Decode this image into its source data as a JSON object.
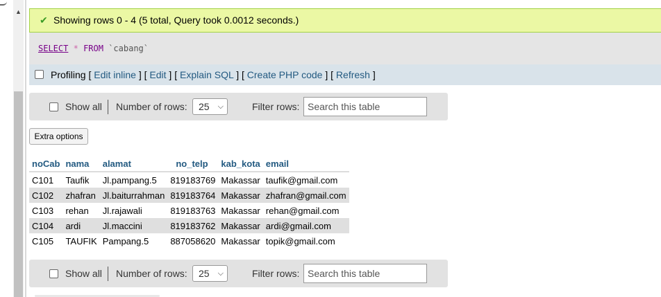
{
  "success": {
    "message": "Showing rows 0 - 4 (5 total, Query took 0.0012 seconds.)"
  },
  "sql": {
    "select": "SELECT",
    "star": "*",
    "from": "FROM",
    "table": "`cabang`"
  },
  "profiling": {
    "label": "Profiling",
    "links": [
      "Edit inline",
      "Edit",
      "Explain SQL",
      "Create PHP code",
      "Refresh"
    ]
  },
  "nav": {
    "show_all": "Show all",
    "number_of_rows": "Number of rows:",
    "rows_value": "25",
    "filter_rows": "Filter rows:",
    "search_placeholder": "Search this table"
  },
  "extra_options": "Extra options",
  "table": {
    "columns": [
      "noCab",
      "nama",
      "alamat",
      "no_telp",
      "kab_kota",
      "email"
    ],
    "rows": [
      [
        "C101",
        "Taufik",
        "Jl.pampang.5",
        "819183769",
        "Makassar",
        "taufik@gmail.com"
      ],
      [
        "C102",
        "zhafran",
        "Jl.baiturrahman",
        "819183764",
        "Makassar",
        "zhafran@gmail.com"
      ],
      [
        "C103",
        "rehan",
        "Jl.rajawali",
        "819183763",
        "Makassar",
        "rehan@gmail.com"
      ],
      [
        "C104",
        "ardi",
        "Jl.maccini",
        "819183762",
        "Makassar",
        "ardi@gmail.com"
      ],
      [
        "C105",
        "TAUFIK",
        "Pampang.5",
        "887058620",
        "Makassar",
        "topik@gmail.com"
      ]
    ]
  },
  "colors": {
    "success_bg": "#ebf8a4",
    "link": "#235a81",
    "profiling_bg": "#d9e3ea"
  }
}
